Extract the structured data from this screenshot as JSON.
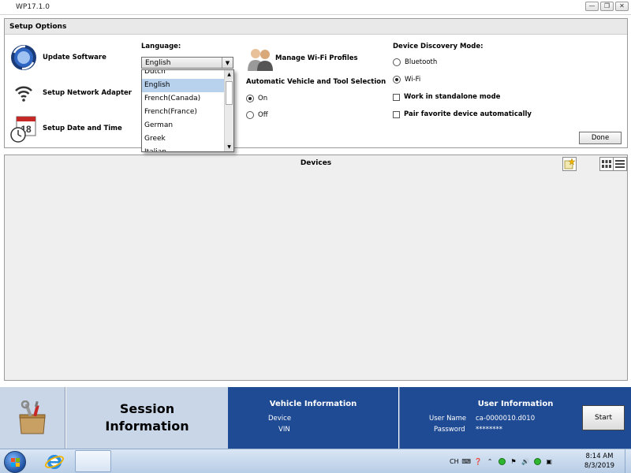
{
  "window": {
    "title": "WP17.1.0"
  },
  "setup": {
    "heading": "Setup Options",
    "update_software": "Update Software",
    "setup_network": "Setup Network Adapter",
    "setup_date": "Setup Date and Time",
    "calendar_number": "18",
    "language_label": "Language:",
    "language_value": "English",
    "language_options": [
      "Dutch",
      "English",
      "French(Canada)",
      "French(France)",
      "German",
      "Greek",
      "Italian"
    ],
    "manage_wifi": "Manage Wi-Fi Profiles",
    "auto_selection_label": "Automatic Vehicle and Tool Selection",
    "auto_on": "On",
    "auto_off": "Off",
    "discovery_label": "Device Discovery Mode:",
    "bluetooth": "Bluetooth",
    "wifi": "Wi-Fi",
    "standalone": "Work in standalone mode",
    "pair_favorite": "Pair favorite device automatically",
    "done": "Done"
  },
  "devices": {
    "title": "Devices"
  },
  "session": {
    "title_line1": "Session",
    "title_line2": "Information",
    "vehicle_title": "Vehicle Information",
    "device_label": "Device",
    "vin_label": "VIN",
    "user_title": "User Information",
    "username_label": "User Name",
    "username_value": "ca-0000010.d010",
    "password_label": "Password",
    "password_value": "********",
    "start": "Start"
  },
  "taskbar": {
    "lang": "CH",
    "time": "8:14 AM",
    "date": "8/3/2019"
  },
  "colors": {
    "session_blue": "#1f4a94",
    "session_light": "#c9d6e8",
    "dropdown_highlight": "#b8d2ee"
  }
}
